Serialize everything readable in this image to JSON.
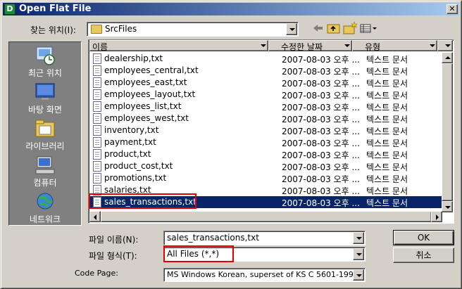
{
  "window": {
    "title": "Open Flat File",
    "app_letter": "D",
    "close_glyph": "✕"
  },
  "lookin": {
    "label": "찾는 위치(I):",
    "value": "SrcFiles"
  },
  "toolbar": {
    "back_icon": "back-arrow-icon",
    "up_icon": "up-folder-icon",
    "new_folder_icon": "new-folder-icon",
    "view_icon": "view-menu-icon"
  },
  "places": [
    {
      "label": "최근 위치",
      "icon": "recent-icon"
    },
    {
      "label": "바탕 화면",
      "icon": "desktop-icon"
    },
    {
      "label": "라이브러리",
      "icon": "library-icon"
    },
    {
      "label": "컴퓨터",
      "icon": "computer-icon"
    },
    {
      "label": "네트워크",
      "icon": "network-icon"
    }
  ],
  "columns": {
    "name": "이름",
    "modified": "수정한 날짜",
    "type": "유형"
  },
  "files": [
    {
      "name": "dealership,txt",
      "modified": "2007-08-03 오후 ...",
      "type": "텍스트 문서"
    },
    {
      "name": "employees_central,txt",
      "modified": "2007-08-03 오후 ...",
      "type": "텍스트 문서"
    },
    {
      "name": "employees_east,txt",
      "modified": "2007-08-03 오후 ...",
      "type": "텍스트 문서"
    },
    {
      "name": "employees_layout,txt",
      "modified": "2007-08-03 오후 ...",
      "type": "텍스트 문서"
    },
    {
      "name": "employees_list,txt",
      "modified": "2007-08-03 오후 ...",
      "type": "텍스트 문서"
    },
    {
      "name": "employees_west,txt",
      "modified": "2007-08-03 오후 ...",
      "type": "텍스트 문서"
    },
    {
      "name": "inventory,txt",
      "modified": "2007-08-03 오후 ...",
      "type": "텍스트 문서"
    },
    {
      "name": "payment,txt",
      "modified": "2007-08-03 오후 ...",
      "type": "텍스트 문서"
    },
    {
      "name": "product,txt",
      "modified": "2007-08-03 오후 ...",
      "type": "텍스트 문서"
    },
    {
      "name": "product_cost,txt",
      "modified": "2007-08-03 오후 ...",
      "type": "텍스트 문서"
    },
    {
      "name": "promotions,txt",
      "modified": "2007-08-03 오후 ...",
      "type": "텍스트 문서"
    },
    {
      "name": "salaries,txt",
      "modified": "2007-08-03 오후 ...",
      "type": "텍스트 문서"
    },
    {
      "name": "sales_transactions,txt",
      "modified": "2007-08-03 오후 ...",
      "type": "텍스트 문서",
      "selected": true
    }
  ],
  "filename": {
    "label": "파일 이름(N):",
    "value": "sales_transactions,txt"
  },
  "filetype": {
    "label": "파일 형식(T):",
    "value": "All Files (*,*)"
  },
  "codepage": {
    "label": "Code Page:",
    "value": "MS Windows Korean, superset of KS C 5601-1992"
  },
  "buttons": {
    "ok": "OK",
    "cancel": "취소"
  },
  "colors": {
    "title_start": "#0a246a",
    "selection": "#0a246a",
    "highlight_box": "#e00000"
  }
}
